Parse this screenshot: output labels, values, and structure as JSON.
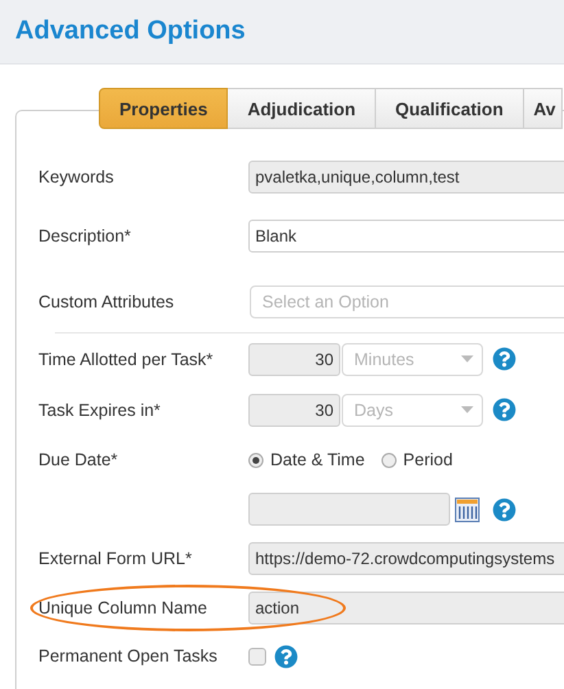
{
  "page": {
    "title": "Advanced Options"
  },
  "tabs": [
    {
      "label": "Properties",
      "selected": true
    },
    {
      "label": "Adjudication",
      "selected": false
    },
    {
      "label": "Qualification",
      "selected": false
    },
    {
      "label": "Av",
      "selected": false
    }
  ],
  "rows": [
    {
      "kind": "text",
      "label": "Keywords",
      "value": "pvaletka,unique,column,test",
      "readonly": true
    },
    {
      "kind": "text",
      "label": "Description*",
      "value": "Blank",
      "readonly": false
    },
    {
      "kind": "select",
      "label": "Custom Attributes",
      "placeholder": "Select an Option",
      "divider": true
    },
    {
      "kind": "duration",
      "label": "Time Allotted per Task*",
      "value": "30",
      "unit": "Minutes",
      "help": true
    },
    {
      "kind": "duration",
      "label": "Task Expires in*",
      "value": "30",
      "unit": "Days",
      "help": true
    },
    {
      "kind": "radio",
      "label": "Due Date*",
      "options": [
        {
          "label": "Date & Time",
          "selected": true
        },
        {
          "label": "Period",
          "selected": false
        }
      ]
    },
    {
      "kind": "date",
      "help": true
    },
    {
      "kind": "text",
      "label": "External Form URL*",
      "value": "https://demo-72.crowdcomputingsystems",
      "readonly": true
    },
    {
      "kind": "text",
      "label": "Unique Column Name",
      "value": "action",
      "readonly": true,
      "highlighted": true
    },
    {
      "kind": "checkbox",
      "label": "Permanent Open Tasks",
      "checked": false,
      "help": true
    }
  ]
}
